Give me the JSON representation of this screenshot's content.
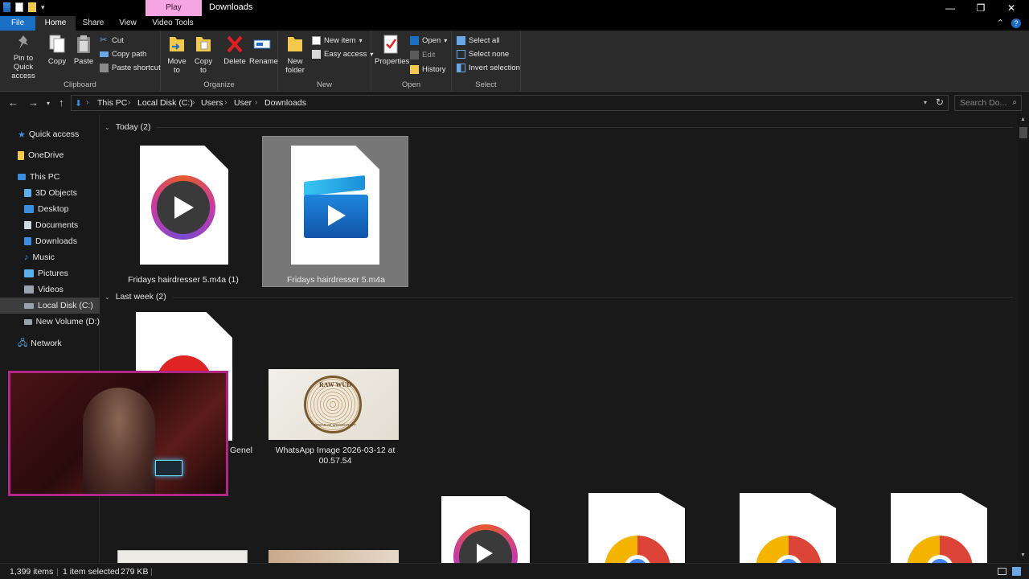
{
  "window": {
    "title": "Downloads",
    "context_tab": "Play",
    "controls": [
      "—",
      "❐",
      "✕"
    ]
  },
  "ribbon_tabs": [
    "File",
    "Home",
    "Share",
    "View",
    "Video Tools"
  ],
  "ribbon": {
    "clipboard": {
      "group_label": "Clipboard",
      "pin": "Pin to Quick access",
      "copy": "Copy",
      "paste": "Paste",
      "cut": "Cut",
      "copy_path": "Copy path",
      "paste_shortcut": "Paste shortcut"
    },
    "organize": {
      "group_label": "Organize",
      "move_to": "Move to",
      "copy_to": "Copy to",
      "delete": "Delete",
      "rename": "Rename"
    },
    "new": {
      "group_label": "New",
      "new_folder": "New folder",
      "new_item": "New item",
      "easy_access": "Easy access"
    },
    "open": {
      "group_label": "Open",
      "properties": "Properties",
      "open": "Open",
      "edit": "Edit",
      "history": "History"
    },
    "select": {
      "group_label": "Select",
      "select_all": "Select all",
      "select_none": "Select none",
      "invert_selection": "Invert selection"
    }
  },
  "address": {
    "breadcrumbs": [
      "This PC",
      "Local Disk (C:)",
      "Users",
      "User",
      "Downloads"
    ],
    "search_placeholder": "Search Do..."
  },
  "sidebar": {
    "items": [
      {
        "label": "Quick access",
        "icon": "star-icon"
      },
      {
        "label": "OneDrive",
        "icon": "cloud-icon"
      },
      {
        "label": "This PC",
        "icon": "computer-icon"
      },
      {
        "label": "3D Objects",
        "icon": "cube-icon"
      },
      {
        "label": "Desktop",
        "icon": "desktop-icon"
      },
      {
        "label": "Documents",
        "icon": "document-icon"
      },
      {
        "label": "Downloads",
        "icon": "download-icon"
      },
      {
        "label": "Music",
        "icon": "music-icon"
      },
      {
        "label": "Pictures",
        "icon": "picture-icon"
      },
      {
        "label": "Videos",
        "icon": "video-icon"
      },
      {
        "label": "Local Disk (C:)",
        "icon": "drive-icon"
      },
      {
        "label": "New Volume (D:)",
        "icon": "drive-icon"
      },
      {
        "label": "Network",
        "icon": "network-icon"
      }
    ],
    "selected": "Local Disk (C:)"
  },
  "groups": [
    {
      "header": "Today (2)"
    },
    {
      "header": "Last week (2)"
    }
  ],
  "files": {
    "today_1": "Fridays hairdresser 5.m4a (1)",
    "today_2": "Fridays hairdresser 5.m4a",
    "lastweek_1": "Genel",
    "lastweek_2_line1": "WhatsApp Image 2026-03-12 at",
    "lastweek_2_line2": "00.57.54",
    "logo_line1": "RAW WUD",
    "logo_line2": "PREMIUM WOODCRAFT"
  },
  "status": {
    "items_count": "1,399 items",
    "selection": "1 item selected",
    "size": "279 KB"
  },
  "colors": {
    "accent": "#1a6ec4",
    "context_tab": "#f6a5e3",
    "background": "#191919",
    "ribbon": "#2b2b2b",
    "selection": "#777777",
    "webcam_border": "#b02788"
  }
}
